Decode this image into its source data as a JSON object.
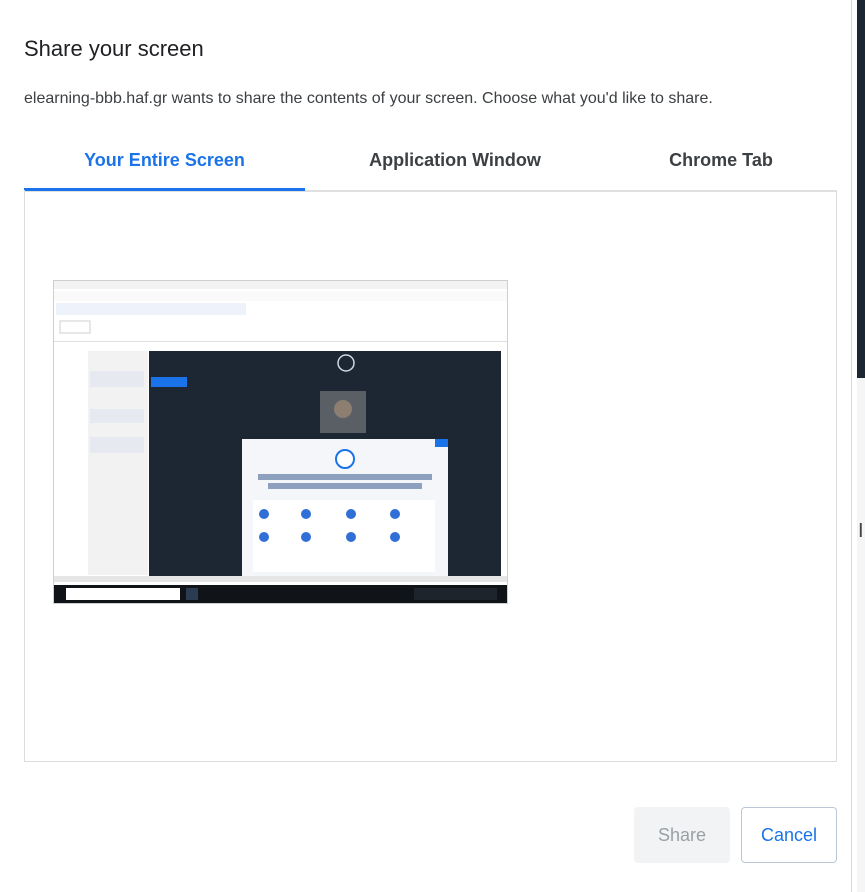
{
  "dialog": {
    "title": "Share your screen",
    "subtitle": "elearning-bbb.haf.gr wants to share the contents of your screen. Choose what you'd like to share."
  },
  "tabs": [
    {
      "label": "Your Entire Screen",
      "active": true
    },
    {
      "label": "Application Window",
      "active": false
    },
    {
      "label": "Chrome Tab",
      "active": false
    }
  ],
  "buttons": {
    "share_label": "Share",
    "cancel_label": "Cancel"
  },
  "colors": {
    "accent": "#1a73e8",
    "meeting_dark": "#1d2633"
  }
}
